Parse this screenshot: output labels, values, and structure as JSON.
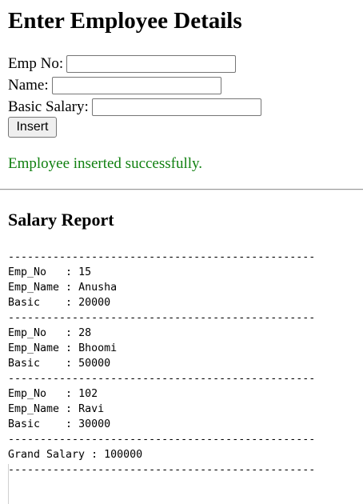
{
  "form": {
    "heading": "Enter Employee Details",
    "emp_no_label": "Emp No:",
    "emp_no_value": "",
    "name_label": "Name:",
    "name_value": "",
    "salary_label": "Basic Salary:",
    "salary_value": "",
    "insert_label": "Insert"
  },
  "message": {
    "text": "Employee inserted successfully.",
    "color": "#108010"
  },
  "report": {
    "heading": "Salary Report",
    "separator": "------------------------------------------------",
    "field_labels": {
      "emp_no": "Emp_No   : ",
      "emp_name": "Emp_Name : ",
      "basic": "Basic    : "
    },
    "employees": [
      {
        "emp_no": "15",
        "emp_name": "Anusha",
        "basic": "20000"
      },
      {
        "emp_no": "28",
        "emp_name": "Bhoomi",
        "basic": "50000"
      },
      {
        "emp_no": "102",
        "emp_name": "Ravi",
        "basic": "30000"
      }
    ],
    "grand_label": "Grand Salary : ",
    "grand_value": "100000"
  }
}
